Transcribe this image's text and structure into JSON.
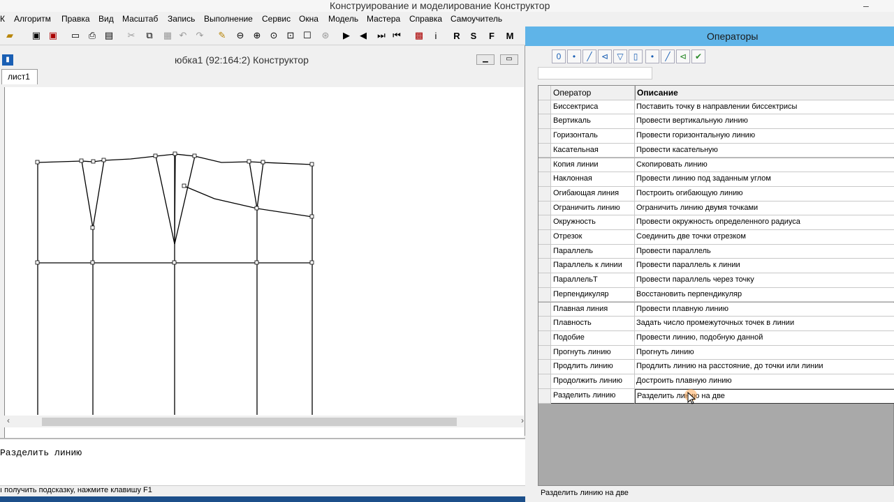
{
  "app": {
    "title": "Конструирование и моделирование  Конструктор",
    "min_glyph": "–"
  },
  "menu": [
    "К",
    "Алгоритм",
    "Правка",
    "Вид",
    "Масштаб",
    "Запись",
    "Выполнение",
    "Сервис",
    "Окна",
    "Модель",
    "Мастера",
    "Справка",
    "Самоучитель"
  ],
  "toolbar": {
    "icons": [
      "open-icon",
      "save-icon",
      "save-all-icon",
      "print-setup-icon",
      "print-icon",
      "preview-icon",
      "cut-icon",
      "copy-icon",
      "paste-icon",
      "undo-icon",
      "redo-icon",
      "pencil-icon",
      "zoom-out-icon",
      "zoom-in-icon",
      "zoom-fit-icon",
      "zoom-window-icon",
      "zoom-box-icon",
      "zoom-all-icon",
      "play-icon",
      "step-back-icon",
      "step-forward-icon",
      "to-start-icon",
      "chip-icon",
      "info-icon"
    ],
    "letters": [
      "R",
      "S",
      "F",
      "M"
    ]
  },
  "child": {
    "title": "юбка1 (92:164:2) Конструктор",
    "tab": "лист1"
  },
  "command": {
    "text": "Разделить линию",
    "hint": "ı получить подсказку, нажмите клавишу F1"
  },
  "operators": {
    "title": "Операторы",
    "tools": [
      "0",
      "•",
      "╱",
      "⊲",
      "▽",
      "▯",
      "•",
      "╱",
      "⊲",
      "✔"
    ],
    "columns": {
      "op": "Оператор",
      "desc": "Описание"
    },
    "rows": [
      {
        "op": "Биссектриса",
        "desc": "Поставить точку в направлении биссектрисы"
      },
      {
        "op": "Вертикаль",
        "desc": "Провести вертикальную линию"
      },
      {
        "op": "Горизонталь",
        "desc": "Провести горизонтальную линию"
      },
      {
        "op": "Касательная",
        "desc": "Провести касательную"
      },
      {
        "op": "Копия линии",
        "desc": "Скопировать линию"
      },
      {
        "op": "Наклонная",
        "desc": "Провести линию под заданным углом"
      },
      {
        "op": "Огибающая линия",
        "desc": "Построить огибающую линию"
      },
      {
        "op": "Ограничить линию",
        "desc": "Ограничить линию двумя точками"
      },
      {
        "op": "Окружность",
        "desc": "Провести окружность определенного радиуса"
      },
      {
        "op": "Отрезок",
        "desc": "Соединить две точки отрезком"
      },
      {
        "op": "Параллель",
        "desc": "Провести параллель"
      },
      {
        "op": "Параллель к линии",
        "desc": "Провести параллель к линии"
      },
      {
        "op": "ПараллельТ",
        "desc": "Провести параллель через точку"
      },
      {
        "op": "Перпендикуляр",
        "desc": "Восстановить перпендикуляр"
      },
      {
        "op": "Плавная линия",
        "desc": "Провести плавную линию"
      },
      {
        "op": "Плавность",
        "desc": "Задать число промежуточных точек в линии"
      },
      {
        "op": "Подобие",
        "desc": "Провести линию, подобную данной"
      },
      {
        "op": "Прогнуть линию",
        "desc": "Прогнуть линию"
      },
      {
        "op": "Продлить линию",
        "desc": "Продлить линию на расстояние, до точки или линии"
      },
      {
        "op": "Продолжить линию",
        "desc": "Достроить плавную линию"
      },
      {
        "op": "Разделить линию",
        "desc": "Разделить линию на две"
      }
    ],
    "status": "Разделить линию на две"
  }
}
